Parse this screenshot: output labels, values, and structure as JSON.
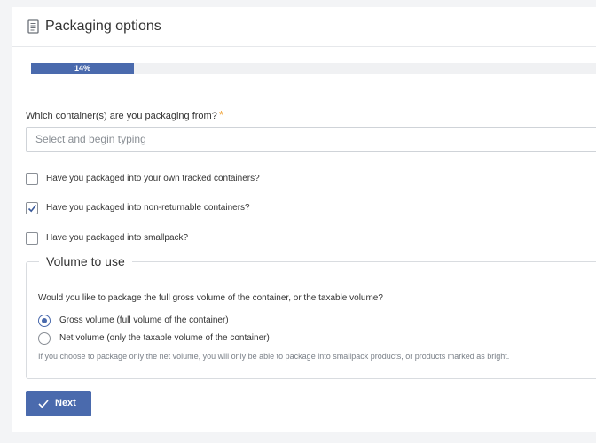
{
  "header": {
    "title": "Packaging options",
    "icon": "document-icon"
  },
  "progress": {
    "label": "14%",
    "value": 0.14
  },
  "container_question": {
    "label": "Which container(s) are you packaging from?",
    "required_mark": "*",
    "placeholder": "Select and begin typing",
    "value": ""
  },
  "checkboxes": [
    {
      "label": "Have you packaged into your own tracked containers?",
      "checked": false
    },
    {
      "label": "Have you packaged into non-returnable containers?",
      "checked": true
    },
    {
      "label": "Have you packaged into smallpack?",
      "checked": false
    }
  ],
  "volume": {
    "legend": "Volume to use",
    "question": "Would you like to package the full gross volume of the container, or the taxable volume?",
    "options": [
      {
        "label": "Gross volume (full volume of the container)",
        "selected": true
      },
      {
        "label": "Net volume (only the taxable volume of the container)",
        "selected": false
      }
    ],
    "help": "If you choose to package only the net volume, you will only be able to package into smallpack products, or products marked as bright."
  },
  "actions": {
    "next_label": "Next"
  },
  "colors": {
    "accent": "#4a6aad",
    "required": "#f0a030"
  }
}
